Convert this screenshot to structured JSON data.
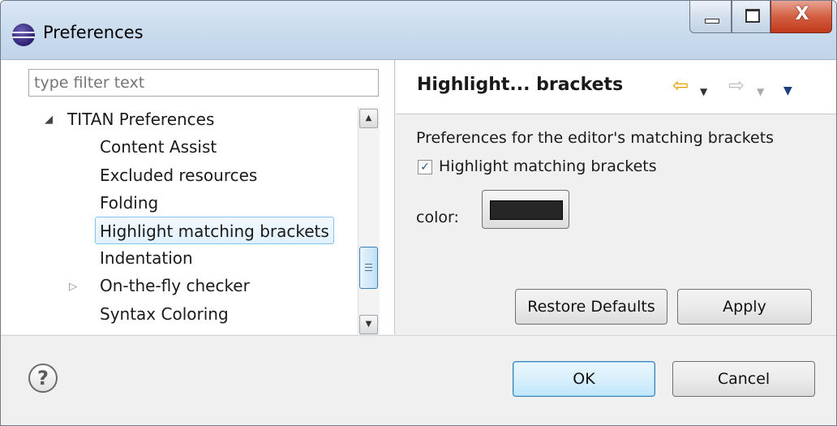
{
  "window": {
    "title": "Preferences",
    "controls": {
      "close_label": "X"
    }
  },
  "sidebar": {
    "filter_placeholder": "type filter text",
    "tree": [
      {
        "label": "TITAN Preferences",
        "expanded": true
      },
      {
        "label": "Content Assist"
      },
      {
        "label": "Excluded resources"
      },
      {
        "label": "Folding"
      },
      {
        "label": "Highlight matching brackets",
        "selected": true
      },
      {
        "label": "Indentation"
      },
      {
        "label": "On-the-fly checker",
        "expanded": false
      },
      {
        "label": "Syntax Coloring"
      }
    ],
    "scroll_position": 0.6
  },
  "page": {
    "title": "Highlight... brackets",
    "description": "Preferences for the editor's matching brackets",
    "checkbox_label": "Highlight matching brackets",
    "checkbox_checked": true,
    "color_label": "color:",
    "color_value": "#262626",
    "restore_label": "Restore Defaults",
    "apply_label": "Apply"
  },
  "footer": {
    "help_glyph": "?",
    "ok_label": "OK",
    "cancel_label": "Cancel"
  },
  "colors": {
    "nav_back": "#e5a000",
    "selection_border": "#84c2ea"
  }
}
